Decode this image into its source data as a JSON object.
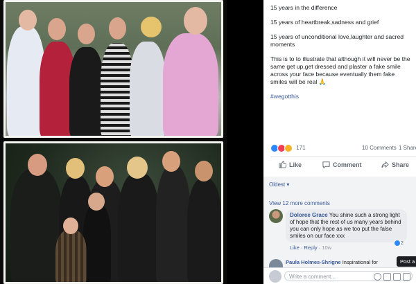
{
  "post": {
    "paragraphs": [
      "15 years in the difference",
      "15 years of heartbreak,sadness and grief",
      "15 years of unconditional love,laughter and sacred moments",
      "This is to to illustrate that although it will never be the same get up,get dressed and plaster a fake smile across your face because eventually them fake smiles will be real 🙏"
    ],
    "hashtag": "#wegotthis"
  },
  "reactions": {
    "count": "171",
    "comments": "10 Comments",
    "shares": "1 Share",
    "icons": [
      "like-icon",
      "love-icon",
      "sad-icon"
    ]
  },
  "actions": {
    "like": "Like",
    "comment": "Comment",
    "share": "Share"
  },
  "comments": {
    "sort": "Oldest ▾",
    "view_more": "View 12 more comments",
    "first": {
      "name": "Doloree Grace",
      "text": "You shine such a strong light of hope that the rest of us many years behind you can only hope as we too put the false smiles on our face xxx",
      "like": "Like",
      "reply": "Reply",
      "time": "10w",
      "reaction_count": "2"
    },
    "second_partial_name": "Paula Holmes-Shrigne",
    "second_partial_text": "Inspirational for"
  },
  "write": {
    "placeholder": "Write a comment...",
    "tooltip": "Post a"
  },
  "colors": {
    "link": "#385898",
    "like_blue": "#2d88ff",
    "love_red": "#f33e58",
    "sad_yellow": "#f7b125"
  }
}
